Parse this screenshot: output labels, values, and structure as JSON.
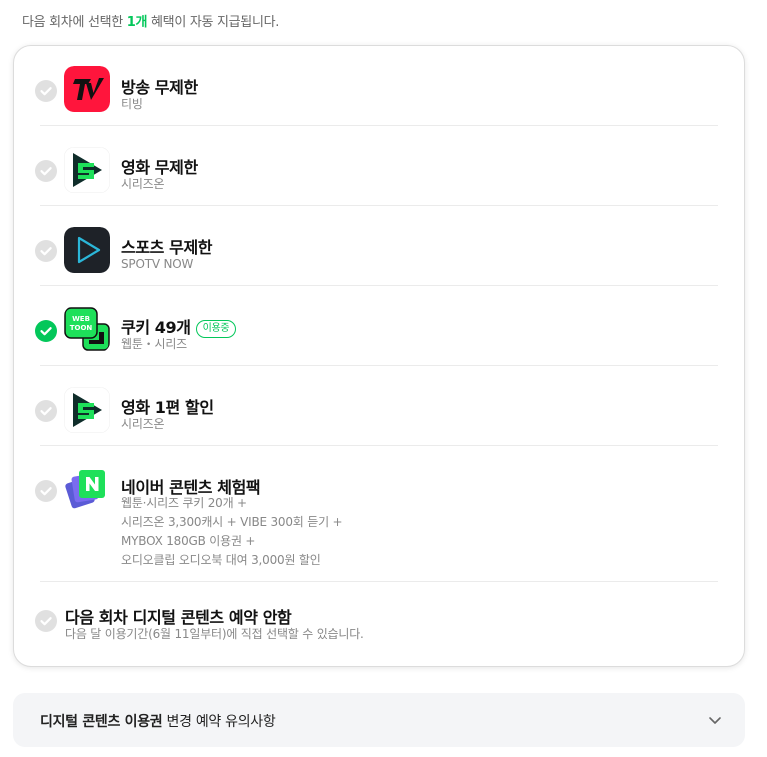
{
  "notice": {
    "prefix": "다음 회차에 선택한 ",
    "highlight": "1개",
    "suffix": " 혜택이 자동 지급됩니다."
  },
  "options": [
    {
      "title": "방송 무제한",
      "subtitle": "티빙",
      "icon": "tving-logo-icon",
      "selected": false
    },
    {
      "title": "영화 무제한",
      "subtitle": "시리즈온",
      "icon": "serieson-logo-icon",
      "selected": false
    },
    {
      "title": "스포츠 무제한",
      "subtitle": "SPOTV NOW",
      "icon": "spotv-now-logo-icon",
      "selected": false
    },
    {
      "title": "쿠키 49개",
      "badge": "이용중",
      "subtitle": "웹툰・시리즈",
      "icon": "webtoon-logo-icon",
      "selected": true
    },
    {
      "title": "영화 1편 할인",
      "subtitle": "시리즈온",
      "icon": "serieson-logo-icon",
      "selected": false
    },
    {
      "title": "네이버 콘텐츠 체험팩",
      "subtitle_lines": [
        "웹툰·시리즈 쿠키 20개 +",
        "시리즈온 3,300캐시 + VIBE 300회 듣기 +",
        "MYBOX 180GB 이용권 +",
        "오디오클립 오디오북 대여 3,000원 할인"
      ],
      "icon": "naver-content-pack-icon",
      "selected": false
    },
    {
      "title": "다음 회차 디지털 콘텐츠 예약 안함",
      "subtitle": "다음 달 이용기간(6월 11일부터)에 직접 선택할 수 있습니다.",
      "selected": false
    }
  ],
  "accordion": {
    "label_bold": "디지털 콘텐츠 이용권",
    "label_rest": " 변경 예약 유의사항"
  },
  "colors": {
    "accent": "#03c75a",
    "radio_off": "#e0e0e0"
  }
}
